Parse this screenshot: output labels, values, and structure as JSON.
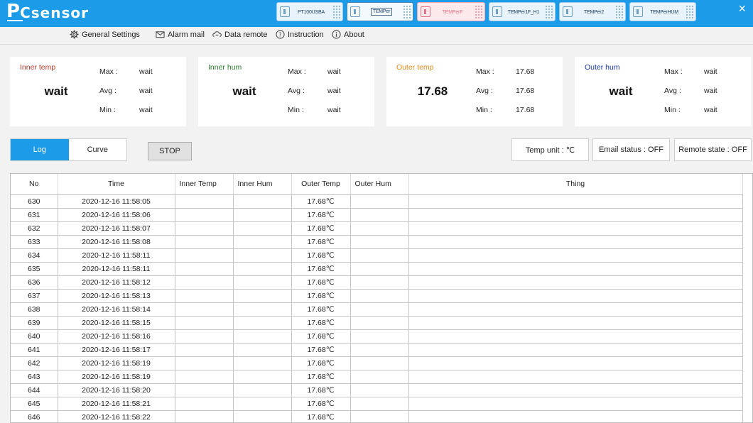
{
  "app": {
    "logo_big": "P",
    "logo_small": "Csensor",
    "close_glyph": "×"
  },
  "devices": [
    {
      "name": "PT100USBA",
      "state": "normal"
    },
    {
      "name": "TEMPer",
      "state": "selected"
    },
    {
      "name": "TEMPerF",
      "state": "inactive"
    },
    {
      "name": "TEMPer1F_H1",
      "state": "normal"
    },
    {
      "name": "TEMPer2",
      "state": "normal"
    },
    {
      "name": "TEMPerHUM",
      "state": "normal"
    }
  ],
  "menu": {
    "general_settings": "General Settings",
    "alarm_mail": "Alarm mail",
    "data_remote": "Data remote",
    "instruction": "Instruction",
    "about": "About"
  },
  "cards": {
    "inner_temp": {
      "title": "Inner temp",
      "value": "wait",
      "max_label": "Max :",
      "avg_label": "Avg :",
      "min_label": "Min :",
      "max": "wait",
      "avg": "wait",
      "min": "wait"
    },
    "inner_hum": {
      "title": "Inner hum",
      "value": "wait",
      "max_label": "Max :",
      "avg_label": "Avg :",
      "min_label": "Min :",
      "max": "wait",
      "avg": "wait",
      "min": "wait"
    },
    "outer_temp": {
      "title": "Outer temp",
      "value": "17.68",
      "max_label": "Max :",
      "avg_label": "Avg :",
      "min_label": "Min :",
      "max": "17.68",
      "avg": "17.68",
      "min": "17.68"
    },
    "outer_hum": {
      "title": "Outer hum",
      "value": "wait",
      "max_label": "Max :",
      "avg_label": "Avg :",
      "min_label": "Min :",
      "max": "wait",
      "avg": "wait",
      "min": "wait"
    }
  },
  "colors": {
    "accent": "#1c9be9",
    "inner_temp_title": "#c0392b",
    "inner_hum_title": "#2e7d32",
    "outer_temp_title": "#e08a1e",
    "outer_hum_title": "#1a3a9c"
  },
  "controls": {
    "tab_log": "Log",
    "tab_curve": "Curve",
    "stop": "STOP",
    "temp_unit": "Temp unit : ℃",
    "email_status": "Email status : OFF",
    "remote_state": "Remote state : OFF"
  },
  "table": {
    "columns": [
      "No",
      "Time",
      "Inner Temp",
      "Inner Hum",
      "Outer Temp",
      "Outer Hum",
      "Thing"
    ],
    "rows": [
      [
        "630",
        "2020-12-16 11:58:05",
        "",
        "",
        "17.68℃",
        "",
        ""
      ],
      [
        "631",
        "2020-12-16 11:58:06",
        "",
        "",
        "17.68℃",
        "",
        ""
      ],
      [
        "632",
        "2020-12-16 11:58:07",
        "",
        "",
        "17.68℃",
        "",
        ""
      ],
      [
        "633",
        "2020-12-16 11:58:08",
        "",
        "",
        "17.68℃",
        "",
        ""
      ],
      [
        "634",
        "2020-12-16 11:58:11",
        "",
        "",
        "17.68℃",
        "",
        ""
      ],
      [
        "635",
        "2020-12-16 11:58:11",
        "",
        "",
        "17.68℃",
        "",
        ""
      ],
      [
        "636",
        "2020-12-16 11:58:12",
        "",
        "",
        "17.68℃",
        "",
        ""
      ],
      [
        "637",
        "2020-12-16 11:58:13",
        "",
        "",
        "17.68℃",
        "",
        ""
      ],
      [
        "638",
        "2020-12-16 11:58:14",
        "",
        "",
        "17.68℃",
        "",
        ""
      ],
      [
        "639",
        "2020-12-16 11:58:15",
        "",
        "",
        "17.68℃",
        "",
        ""
      ],
      [
        "640",
        "2020-12-16 11:58:16",
        "",
        "",
        "17.68℃",
        "",
        ""
      ],
      [
        "641",
        "2020-12-16 11:58:17",
        "",
        "",
        "17.68℃",
        "",
        ""
      ],
      [
        "642",
        "2020-12-16 11:58:19",
        "",
        "",
        "17.68℃",
        "",
        ""
      ],
      [
        "643",
        "2020-12-16 11:58:19",
        "",
        "",
        "17.68℃",
        "",
        ""
      ],
      [
        "644",
        "2020-12-16 11:58:20",
        "",
        "",
        "17.68℃",
        "",
        ""
      ],
      [
        "645",
        "2020-12-16 11:58:21",
        "",
        "",
        "17.68℃",
        "",
        ""
      ],
      [
        "646",
        "2020-12-16 11:58:22",
        "",
        "",
        "17.68℃",
        "",
        ""
      ]
    ]
  }
}
